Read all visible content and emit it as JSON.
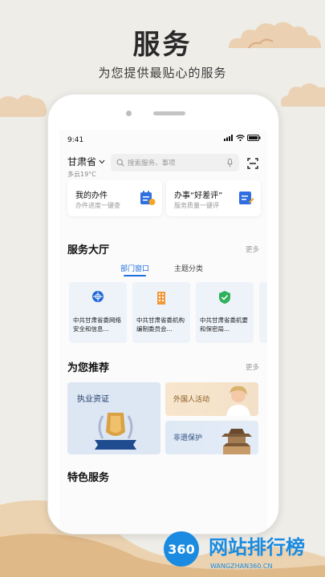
{
  "promo": {
    "title": "服务",
    "subtitle": "为您提供最贴心的服务"
  },
  "status_bar": {
    "time": "9:41"
  },
  "header": {
    "city": "甘肃省",
    "weather": "多云19°C",
    "search_placeholder": "搜索服务、事项"
  },
  "quick_cards": [
    {
      "title": "我的办件",
      "subtitle": "办件进度一键查"
    },
    {
      "title": "办事“好差评”",
      "subtitle": "服务质量一键评"
    }
  ],
  "service_hall": {
    "title": "服务大厅",
    "more": "更多",
    "tabs": [
      "部门窗口",
      "主题分类"
    ],
    "departments": [
      {
        "name": "中共甘肃省委网络安全和信息..."
      },
      {
        "name": "中共甘肃省委机构编制委员会..."
      },
      {
        "name": "中共甘肃省委机要和保密局..."
      }
    ]
  },
  "recommend": {
    "title": "为您推荐",
    "more": "更多",
    "items": [
      "执业资证",
      "外国人活动",
      "非遗保护"
    ]
  },
  "special": {
    "title": "特色服务"
  },
  "colors": {
    "accent": "#1c6fe0",
    "background": "#efede8",
    "card_bg": "#eef3fa"
  }
}
